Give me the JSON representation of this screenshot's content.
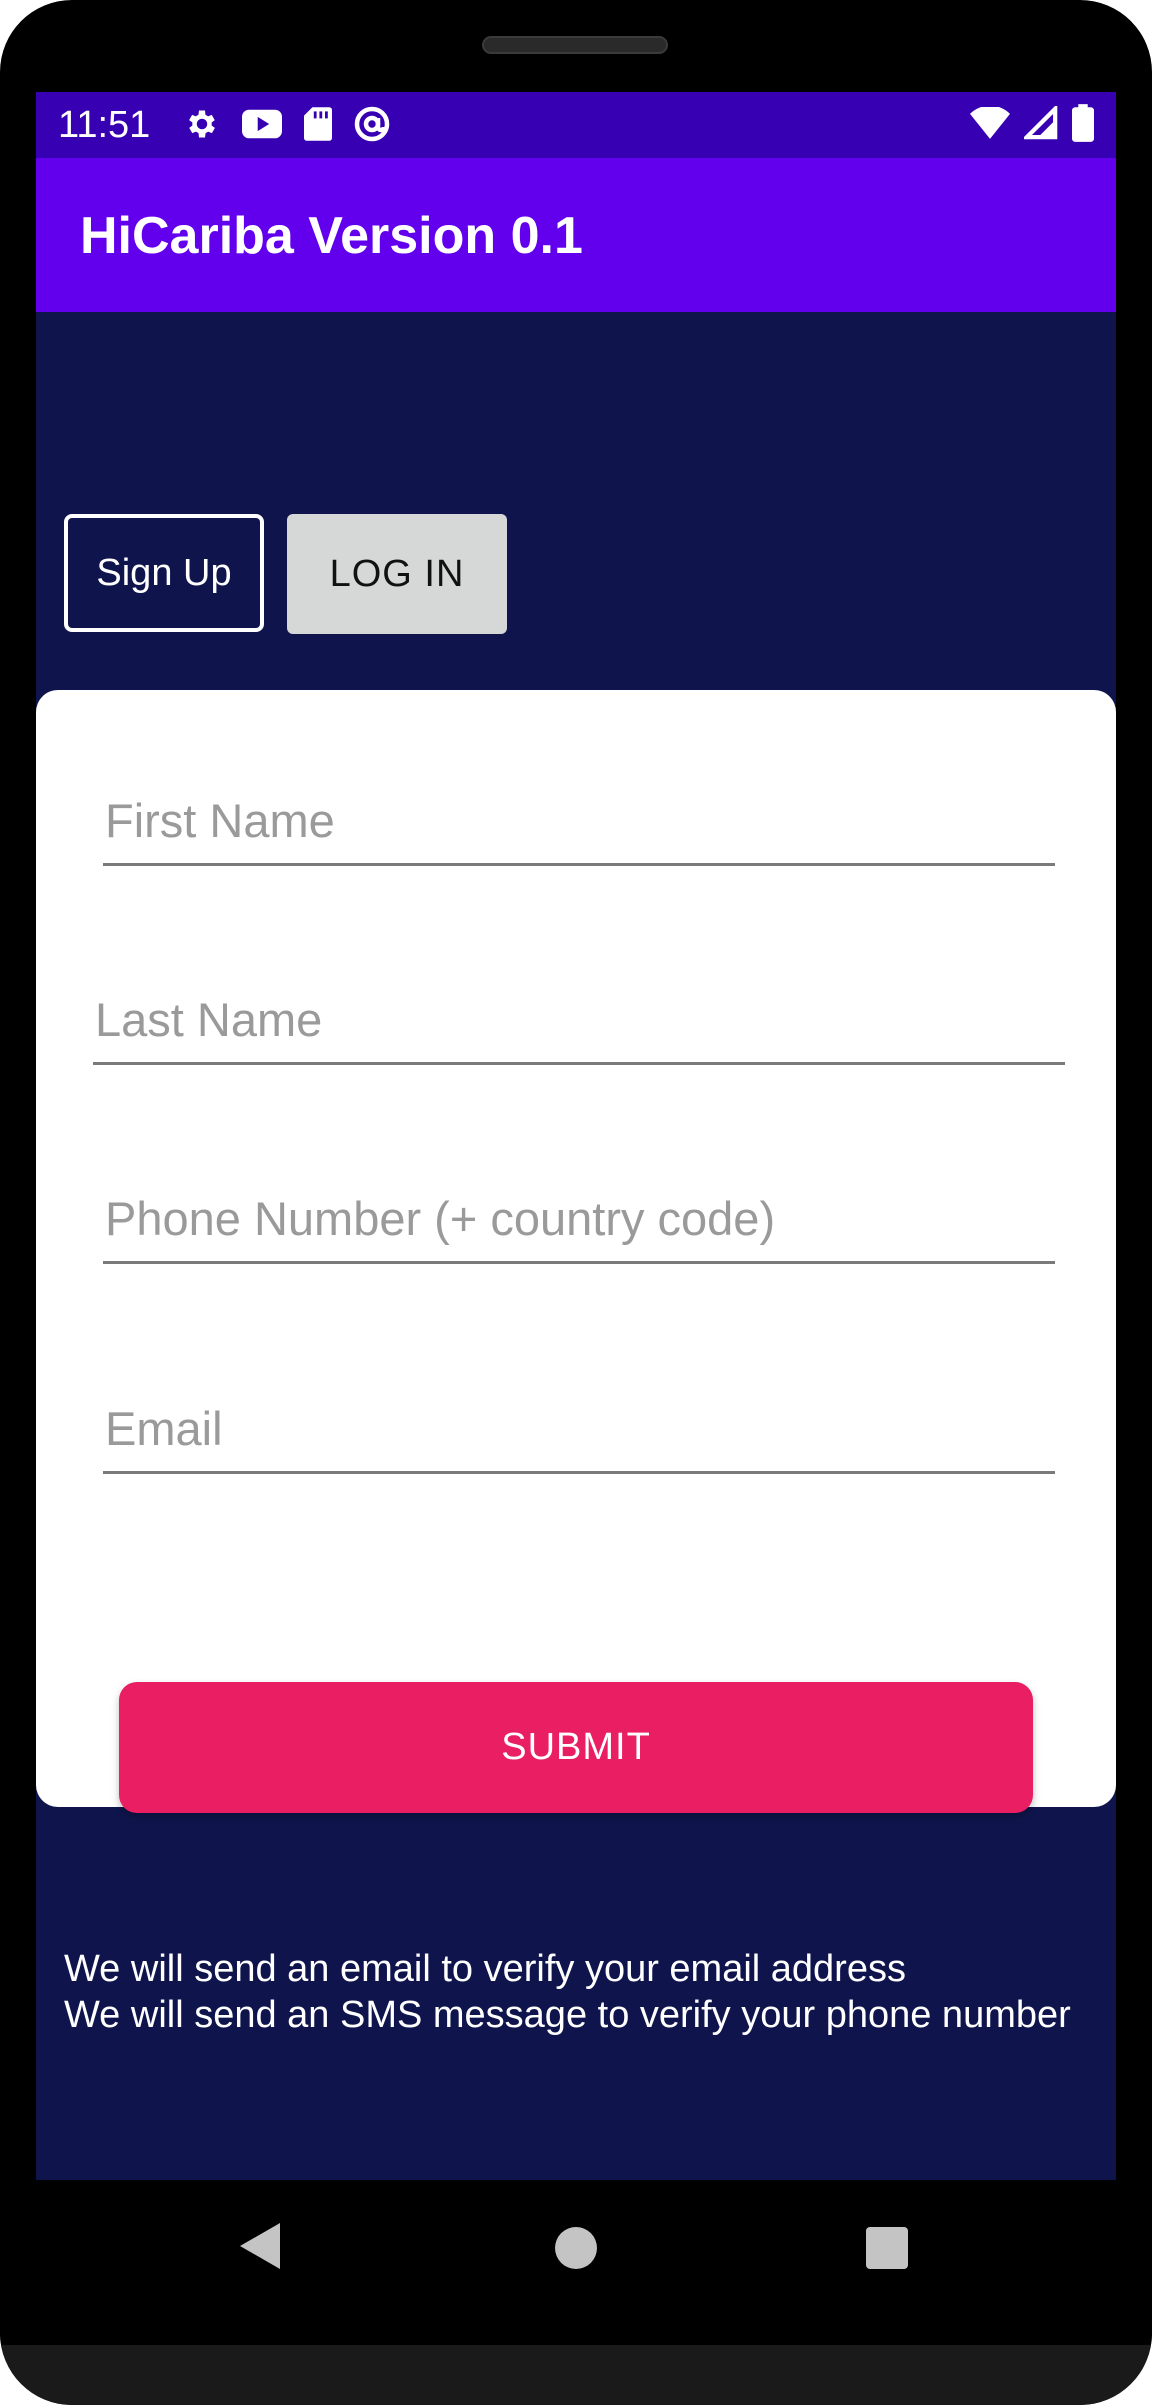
{
  "status_bar": {
    "time": "11:51",
    "left_icons": [
      "gear-icon",
      "youtube-icon",
      "sd-card-icon",
      "at-sign-icon"
    ],
    "right_icons": [
      "wifi-icon",
      "cell-signal-icon",
      "battery-icon"
    ]
  },
  "app_bar": {
    "title": "HiCariba Version 0.1",
    "color": "#6200ee"
  },
  "tabs": {
    "signup_label": "Sign Up",
    "login_label": "LOG IN"
  },
  "form": {
    "first_name": {
      "value": "",
      "placeholder": "First Name"
    },
    "last_name": {
      "value": "",
      "placeholder": "Last Name"
    },
    "phone": {
      "value": "",
      "placeholder": "Phone Number (+ country code)"
    },
    "email": {
      "value": "",
      "placeholder": "Email"
    },
    "submit_label": "SUBMIT"
  },
  "notes": {
    "line1": "We will send an email to verify your email address",
    "line2": "We will send an SMS message to verify your phone number"
  },
  "colors": {
    "status_bar": "#3700b3",
    "background": "#0f154c",
    "submit": "#e91e63",
    "login_tab": "#d6d7d7"
  },
  "nav_bar": {
    "buttons": [
      "back-icon",
      "home-icon",
      "recents-icon"
    ]
  }
}
